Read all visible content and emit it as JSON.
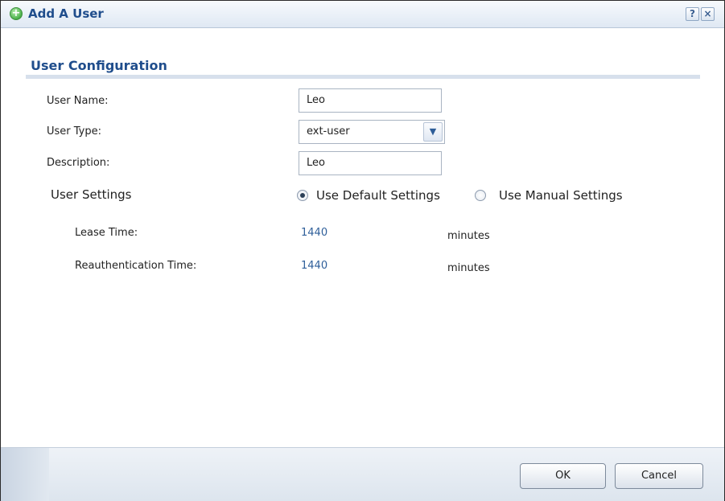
{
  "window": {
    "title": "Add A User",
    "help_label": "?",
    "close_label": "×"
  },
  "section": {
    "title": "User Configuration"
  },
  "form": {
    "user_name": {
      "label": "User Name:",
      "value": "Leo"
    },
    "user_type": {
      "label": "User Type:",
      "value": "ext-user"
    },
    "description": {
      "label": "Description:",
      "value": "Leo"
    }
  },
  "user_settings": {
    "label": "User Settings",
    "options": [
      {
        "label": "Use Default Settings",
        "selected": true
      },
      {
        "label": "Use Manual Settings",
        "selected": false
      }
    ],
    "lease_time": {
      "label": "Lease Time:",
      "value": "1440",
      "unit": "minutes"
    },
    "reauth_time": {
      "label": "Reauthentication Time:",
      "value": "1440",
      "unit": "minutes"
    }
  },
  "buttons": {
    "ok": "OK",
    "cancel": "Cancel"
  },
  "icons": {
    "title": "add-user-icon",
    "dropdown": "chevron-down-icon"
  },
  "colors": {
    "title_text": "#1f4d8c",
    "link_value": "#2f5f9a",
    "section_bar": "#d7e0ec"
  }
}
